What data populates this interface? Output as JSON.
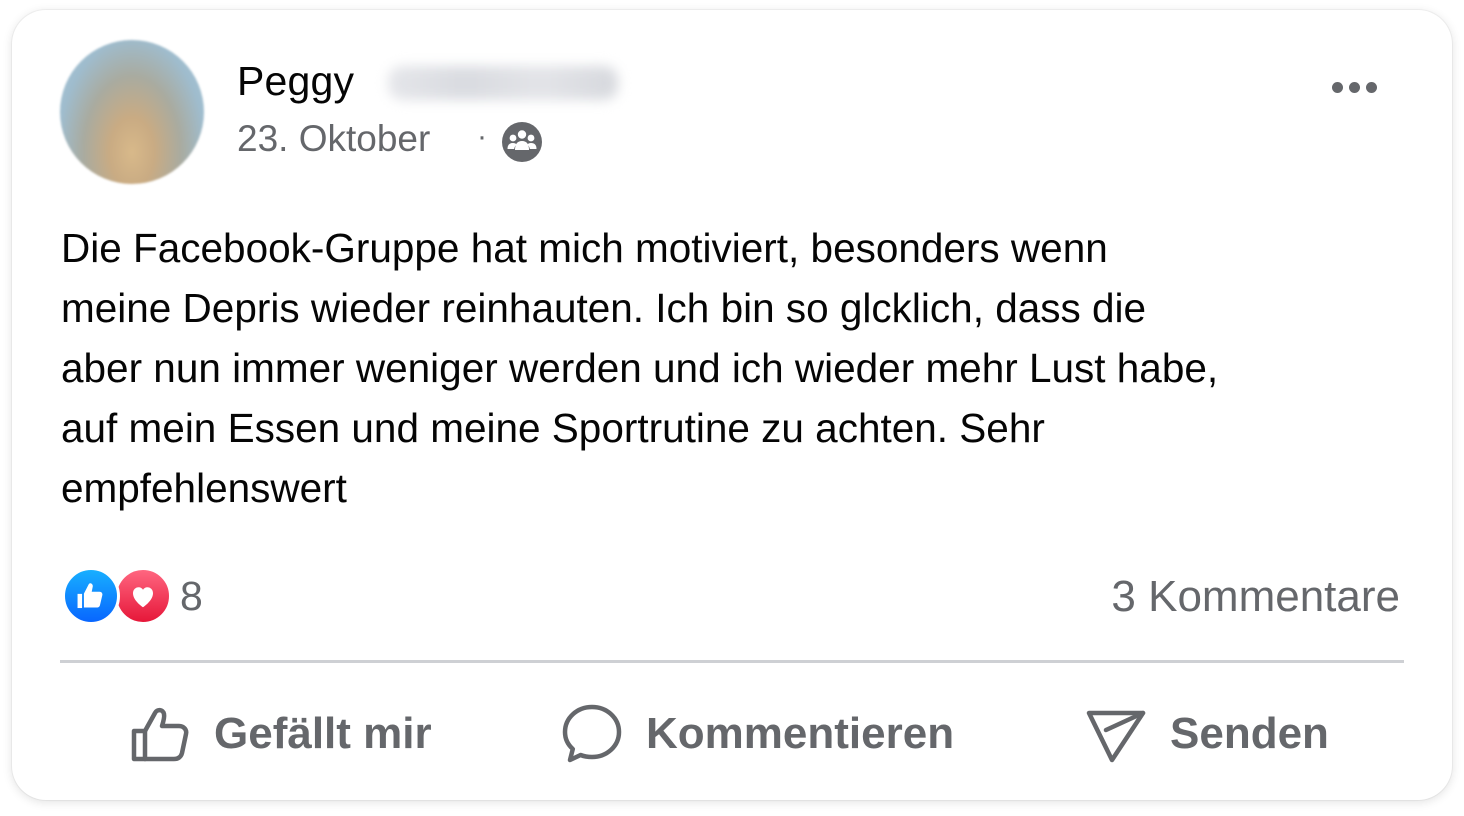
{
  "post": {
    "author": "Peggy",
    "date": "23. Oktober",
    "separator": "·",
    "audience_icon": "group-icon",
    "menu_icon": "more-options-icon",
    "text_lines": [
      "Die Facebook-Gruppe hat mich motiviert, besonders wenn",
      "meine Depris wieder reinhauten. Ich bin so glcklich, dass die",
      "aber nun immer weniger werden und ich wieder mehr Lust habe,",
      "auf mein Essen und meine Sportrutine zu achten. Sehr",
      "empfehlenswert"
    ]
  },
  "stats": {
    "reaction_icons": [
      "like-reaction-icon",
      "love-reaction-icon"
    ],
    "reaction_count": "8",
    "comments": "3 Kommentare"
  },
  "actions": {
    "like": "Gefällt mir",
    "comment": "Kommentieren",
    "send": "Senden"
  },
  "colors": {
    "text_primary": "#050505",
    "text_secondary": "#65676b",
    "like_blue": "#0866ff",
    "love_red": "#f33e58",
    "divider": "#ced0d4"
  }
}
